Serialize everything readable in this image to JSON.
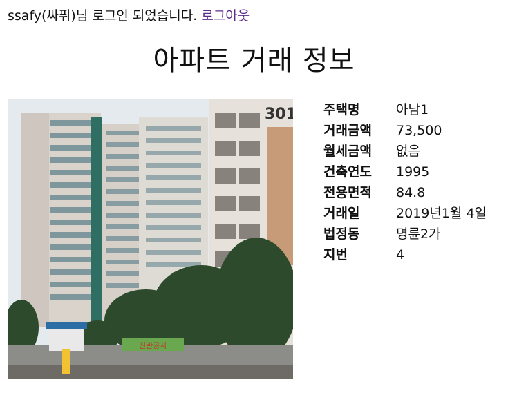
{
  "header": {
    "login_message": "ssafy(싸퓌)님 로그인 되었습니다.",
    "logout_link": "로그아웃"
  },
  "page_title": "아파트 거래 정보",
  "photo": {
    "building_number": "301",
    "banner_text": "진관공사"
  },
  "details": [
    {
      "label": "주택명",
      "value": "아남1"
    },
    {
      "label": "거래금액",
      "value": "73,500"
    },
    {
      "label": "월세금액",
      "value": "없음"
    },
    {
      "label": "건축연도",
      "value": "1995"
    },
    {
      "label": "전용면적",
      "value": "84.8"
    },
    {
      "label": "거래일",
      "value": "2019년1월 4일"
    },
    {
      "label": "법정동",
      "value": "명륜2가"
    },
    {
      "label": "지번",
      "value": "4"
    }
  ],
  "colors": {
    "link": "#5b2b8a",
    "text": "#111111"
  }
}
